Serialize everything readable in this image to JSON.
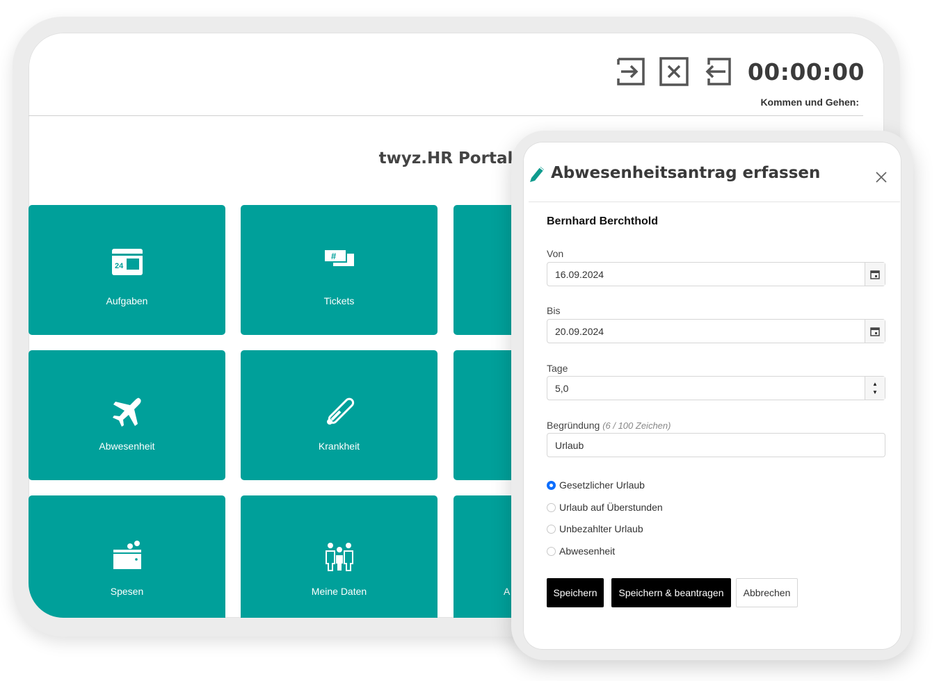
{
  "header": {
    "clock": "00:00:00",
    "subtitle": "Kommen und Gehen:",
    "actions": [
      {
        "icon": "sign-in-icon"
      },
      {
        "icon": "cancel-icon"
      },
      {
        "icon": "sign-out-icon"
      }
    ]
  },
  "portal": {
    "title": "twyz.HR Portal",
    "tiles": [
      {
        "label": "Aufgaben",
        "icon": "calendar-icon"
      },
      {
        "label": "Tickets",
        "icon": "tickets-icon"
      },
      {
        "label": "Abwesenheit",
        "icon": "plane-icon"
      },
      {
        "label": "Krankheit",
        "icon": "thermometer-icon"
      },
      {
        "label": "Spesen",
        "icon": "wallet-icon"
      },
      {
        "label": "Meine Daten",
        "icon": "family-icon"
      },
      {
        "label": "A",
        "icon": ""
      }
    ],
    "accent_color": "#00a09a"
  },
  "dialog": {
    "title": "Abwesenheitsantrag erfassen",
    "employee": "Bernhard Berchthold",
    "von_label": "Von",
    "von_value": "16.09.2024",
    "bis_label": "Bis",
    "bis_value": "20.09.2024",
    "tage_label": "Tage",
    "tage_value": "5,0",
    "begruendung_label": "Begründung",
    "begruendung_hint": "(6 / 100 Zeichen)",
    "begruendung_value": "Urlaub",
    "options": [
      {
        "label": "Gesetzlicher Urlaub",
        "checked": true
      },
      {
        "label": "Urlaub auf Überstunden",
        "checked": false
      },
      {
        "label": "Unbezahlter Urlaub",
        "checked": false
      },
      {
        "label": "Abwesenheit",
        "checked": false
      }
    ],
    "buttons": {
      "save": "Speichern",
      "save_apply": "Speichern & beantragen",
      "cancel": "Abbrechen"
    },
    "spin_up": "▲",
    "spin_down": "▼"
  }
}
